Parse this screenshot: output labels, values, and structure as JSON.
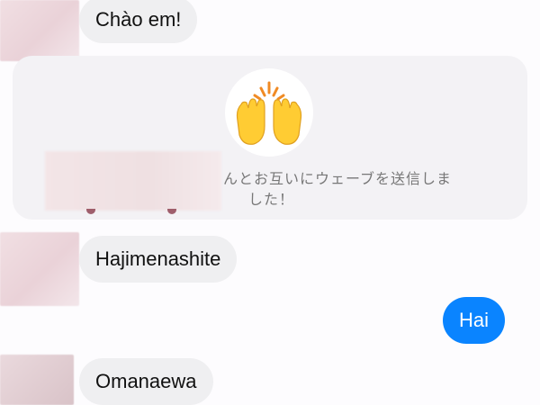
{
  "messages": {
    "msg1": "Chào em!",
    "msg2": "Hajimenashite",
    "msg3": "Hai",
    "msg4": "Omanaewa"
  },
  "wave": {
    "line1": "んとお互いにウェーブを送信しま",
    "line2": "した！",
    "icon": "raised-hands-emoji"
  },
  "colors": {
    "outgoing_bubble": "#0a84ff",
    "incoming_bubble": "#efeff1",
    "card_bg": "#f3f2f5"
  }
}
